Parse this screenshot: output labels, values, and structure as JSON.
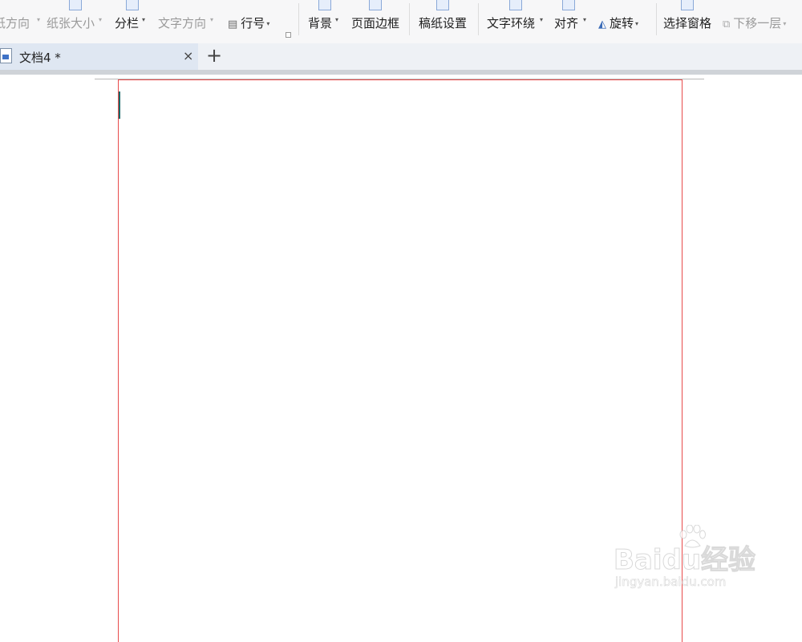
{
  "ribbon": {
    "orientation": "纸方向",
    "paper_size": "纸张大小",
    "columns": "分栏",
    "text_direction": "文字方向",
    "line_numbers": "行号",
    "background": "背景",
    "page_border": "页面边框",
    "draft_paper": "稿纸设置",
    "text_wrap": "文字环绕",
    "align": "对齐",
    "rotate": "旋转",
    "selection_pane": "选择窗格",
    "send_backward": "下移一层"
  },
  "tabs": {
    "doc_title": "文档4 *",
    "close": "×",
    "new": "+"
  },
  "watermark": {
    "brand": "Baidu经验",
    "url": "jingyan.baidu.com"
  }
}
